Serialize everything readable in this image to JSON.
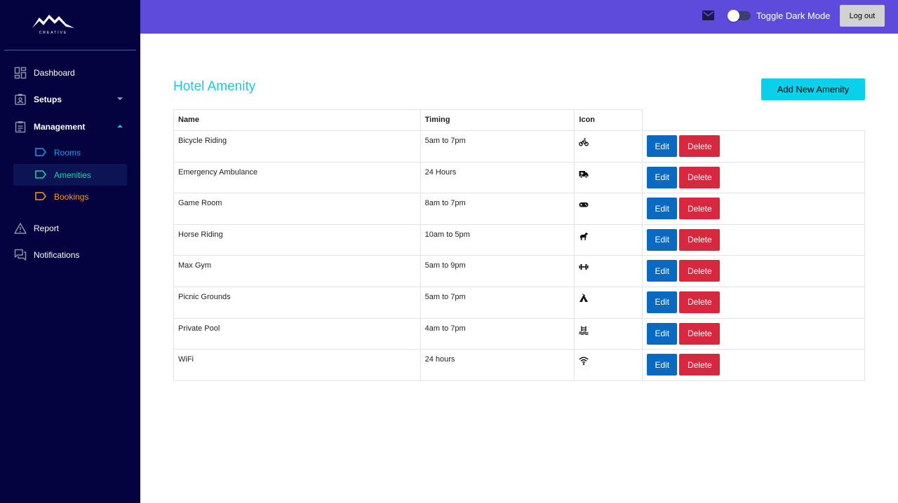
{
  "brand": {
    "logo_text": "CREATIVE"
  },
  "sidebar": {
    "items": [
      {
        "label": "Dashboard",
        "icon": "dashboard-icon"
      },
      {
        "label": "Setups",
        "icon": "contact-page-icon",
        "expanded": false
      },
      {
        "label": "Management",
        "icon": "clipboard-icon",
        "expanded": true
      },
      {
        "label": "Report",
        "icon": "warning-icon"
      },
      {
        "label": "Notifications",
        "icon": "chat-bubbles-icon"
      }
    ],
    "subitems": [
      {
        "label": "Rooms",
        "color": "#1a9cf0",
        "active": false
      },
      {
        "label": "Amenities",
        "color": "#19d1a8",
        "active": true
      },
      {
        "label": "Bookings",
        "color": "#f39a27",
        "active": false
      }
    ]
  },
  "topbar": {
    "toggle_label": "Toggle Dark Mode",
    "logout_label": "Log out",
    "dark_mode_on": false
  },
  "main": {
    "title": "Hotel Amenity",
    "add_button": "Add New Amenity",
    "table": {
      "columns": [
        "Name",
        "Timing",
        "Icon"
      ],
      "rows": [
        {
          "name": "Bicycle Riding",
          "timing": "5am to 7pm",
          "icon": "bicycle-icon"
        },
        {
          "name": "Emergency Ambulance",
          "timing": "24 Hours",
          "icon": "ambulance-icon"
        },
        {
          "name": "Game Room",
          "timing": "8am to 7pm",
          "icon": "gamepad-icon"
        },
        {
          "name": "Horse Riding",
          "timing": "10am to 5pm",
          "icon": "horse-icon"
        },
        {
          "name": "Max Gym",
          "timing": "5am to 9pm",
          "icon": "dumbbell-icon"
        },
        {
          "name": "Picnic Grounds",
          "timing": "5am to 7pm",
          "icon": "tent-icon"
        },
        {
          "name": "Private Pool",
          "timing": "4am to 7pm",
          "icon": "pool-icon"
        },
        {
          "name": "WiFi",
          "timing": "24 hours",
          "icon": "wifi-icon"
        }
      ],
      "edit_label": "Edit",
      "delete_label": "Delete"
    }
  },
  "colors": {
    "sidebar_bg": "#04033f",
    "topbar_bg": "#5f4bdb",
    "title": "#1bc8dc",
    "add_button": "#0ad0ec",
    "edit_button": "#0b6abf",
    "delete_button": "#d7283f"
  }
}
